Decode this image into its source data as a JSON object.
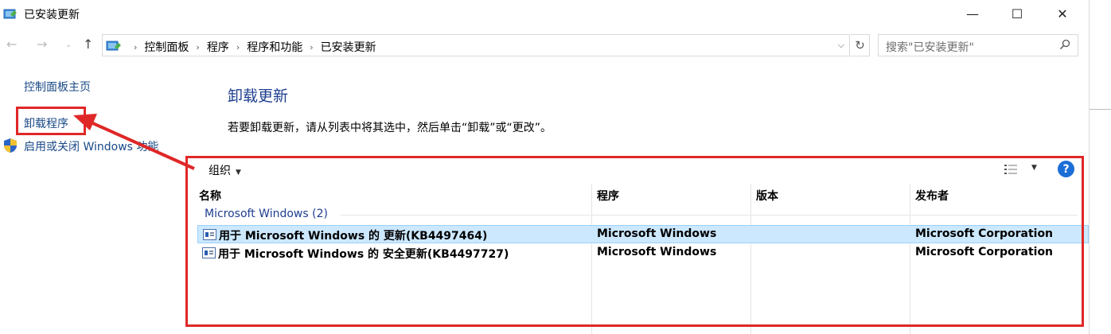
{
  "window": {
    "title": "已安装更新",
    "minimize_symbol": "—",
    "maximize_symbol": "☐",
    "close_symbol": "✕"
  },
  "address_bar": {
    "breadcrumbs": [
      "控制面板",
      "程序",
      "程序和功能",
      "已安装更新"
    ],
    "separator": "›",
    "dropdown_symbol": "⌵",
    "refresh_symbol": "↻"
  },
  "nav": {
    "back": "←",
    "forward": "→",
    "recent": "⌄",
    "up": "↑"
  },
  "search": {
    "placeholder": "搜索\"已安装更新\"",
    "icon": "search-icon"
  },
  "left_pane": {
    "home": "控制面板主页",
    "uninstall_program": "卸载程序",
    "windows_features": "启用或关闭 Windows 功能"
  },
  "main": {
    "title": "卸载更新",
    "description": "若要卸载更新，请从列表中将其选中，然后单击“卸载”或“更改”。"
  },
  "toolbar": {
    "organize": "组织",
    "dropdown_symbol": "▼",
    "help": "?"
  },
  "list": {
    "columns": [
      "名称",
      "程序",
      "版本",
      "发布者"
    ],
    "group": "Microsoft Windows (2)",
    "rows": [
      {
        "name": "用于 Microsoft Windows 的 更新(KB4497464)",
        "program": "Microsoft Windows",
        "version": "",
        "publisher": "Microsoft Corporation",
        "selected": true
      },
      {
        "name": "用于 Microsoft Windows 的 安全更新(KB4497727)",
        "program": "Microsoft Windows",
        "version": "",
        "publisher": "Microsoft Corporation",
        "selected": false
      }
    ]
  },
  "colors": {
    "link": "#1a4a87",
    "heading": "#1e3e8f",
    "selection": "#cce8ff",
    "annotation": "#e02727",
    "help": "#1b6ed6"
  }
}
